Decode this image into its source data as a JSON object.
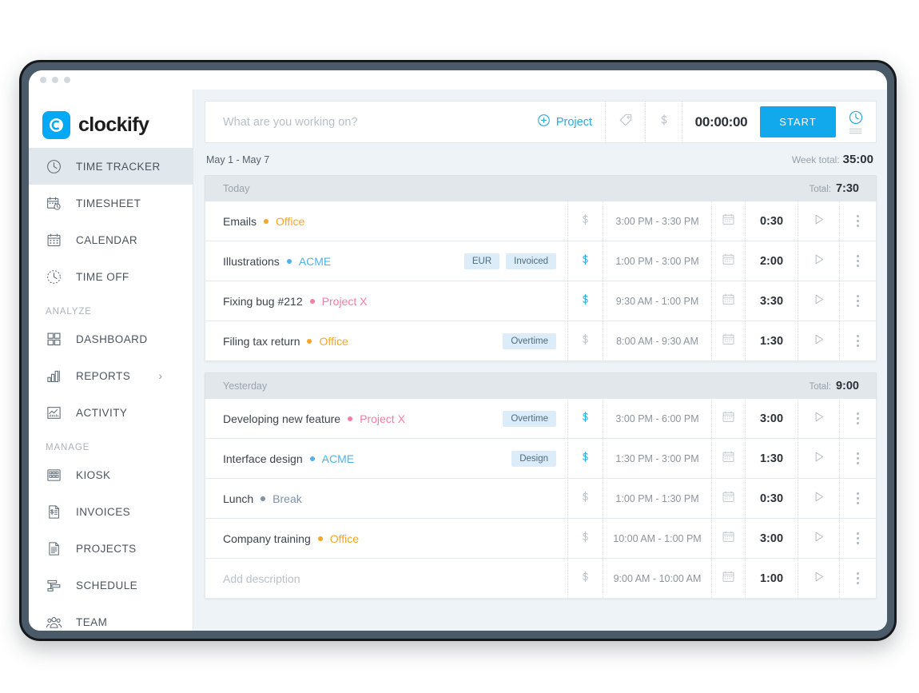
{
  "window": {
    "dots": 3
  },
  "brand": {
    "name": "clockify",
    "logo_icon": "clockify-logo-icon",
    "accent": "#03a9f4"
  },
  "sidebar": {
    "items": [
      {
        "label": "TIME TRACKER",
        "icon": "clock-icon",
        "active": true
      },
      {
        "label": "TIMESHEET",
        "icon": "calendar-clock-icon",
        "active": false
      },
      {
        "label": "CALENDAR",
        "icon": "calendar-icon",
        "active": false
      },
      {
        "label": "TIME OFF",
        "icon": "clock-dashed-icon",
        "active": false
      }
    ],
    "sections": [
      {
        "title": "ANALYZE",
        "items": [
          {
            "label": "DASHBOARD",
            "icon": "grid-icon",
            "chevron": false
          },
          {
            "label": "REPORTS",
            "icon": "bar-chart-icon",
            "chevron": true,
            "chevron_glyph": "›"
          },
          {
            "label": "ACTIVITY",
            "icon": "line-chart-icon",
            "chevron": false
          }
        ]
      },
      {
        "title": "MANAGE",
        "items": [
          {
            "label": "KIOSK",
            "icon": "kiosk-grid-icon",
            "chevron": false
          },
          {
            "label": "INVOICES",
            "icon": "invoice-icon",
            "chevron": false
          },
          {
            "label": "PROJECTS",
            "icon": "document-icon",
            "chevron": false
          },
          {
            "label": "SCHEDULE",
            "icon": "schedule-bars-icon",
            "chevron": false
          },
          {
            "label": "TEAM",
            "icon": "team-people-icon",
            "chevron": false
          }
        ]
      }
    ]
  },
  "timer_bar": {
    "input_value": "",
    "input_placeholder": "What are you working on?",
    "project_label": "Project",
    "project_icon": "plus-circle-icon",
    "tag_icon": "tag-icon",
    "billable_icon": "dollar-icon",
    "duration": "00:00:00",
    "start_label": "START",
    "mode_icon": "timer-mode-icon"
  },
  "week": {
    "range": "May 1 - May 7",
    "total_label": "Week total:",
    "total_value": "35:00"
  },
  "day_groups": [
    {
      "title": "Today",
      "total_label": "Total:",
      "total_value": "7:30",
      "entries": [
        {
          "description": "Emails",
          "is_placeholder": false,
          "project": "Office",
          "project_color": "#f5a623",
          "tags": [],
          "billable": false,
          "time_range": "3:00 PM - 3:30 PM",
          "duration": "0:30"
        },
        {
          "description": "Illustrations",
          "is_placeholder": false,
          "project": "ACME",
          "project_color": "#4fb3e8",
          "tags": [
            "EUR",
            "Invoiced"
          ],
          "billable": true,
          "time_range": "1:00 PM - 3:00 PM",
          "duration": "2:00"
        },
        {
          "description": "Fixing bug #212",
          "is_placeholder": false,
          "project": "Project X",
          "project_color": "#f77ca0",
          "tags": [],
          "billable": true,
          "time_range": "9:30 AM - 1:00 PM",
          "duration": "3:30"
        },
        {
          "description": "Filing tax return",
          "is_placeholder": false,
          "project": "Office",
          "project_color": "#f5a623",
          "tags": [
            "Overtime"
          ],
          "billable": false,
          "time_range": "8:00 AM - 9:30 AM",
          "duration": "1:30"
        }
      ]
    },
    {
      "title": "Yesterday",
      "total_label": "Total:",
      "total_value": "9:00",
      "entries": [
        {
          "description": "Developing new feature",
          "is_placeholder": false,
          "project": "Project X",
          "project_color": "#f77ca0",
          "tags": [
            "Overtime"
          ],
          "billable": true,
          "time_range": "3:00 PM - 6:00 PM",
          "duration": "3:00"
        },
        {
          "description": "Interface design",
          "is_placeholder": false,
          "project": "ACME",
          "project_color": "#4fb3e8",
          "tags": [
            "Design"
          ],
          "billable": true,
          "time_range": "1:30 PM - 3:00 PM",
          "duration": "1:30"
        },
        {
          "description": "Lunch",
          "is_placeholder": false,
          "project": "Break",
          "project_color": "#7d93a8",
          "tags": [],
          "billable": false,
          "time_range": "1:00 PM - 1:30 PM",
          "duration": "0:30"
        },
        {
          "description": "Company training",
          "is_placeholder": false,
          "project": "Office",
          "project_color": "#f5a623",
          "tags": [],
          "billable": false,
          "time_range": "10:00 AM - 1:00 PM",
          "duration": "3:00"
        },
        {
          "description": "Add description",
          "is_placeholder": true,
          "project": "",
          "project_color": "",
          "tags": [],
          "billable": false,
          "time_range": "9:00 AM - 10:00 AM",
          "duration": "1:00"
        }
      ]
    }
  ],
  "icons": {
    "calendar_row_icon": "calendar-small-icon",
    "play_icon": "play-icon",
    "kebab_icon": "kebab-menu-icon"
  }
}
